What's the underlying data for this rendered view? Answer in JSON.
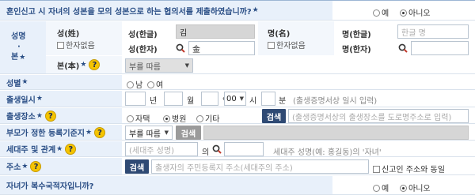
{
  "marriage": {
    "question": "혼인신고 시 자녀의 성본을 모의 성본으로 하는 협의서를 제출하였습니까?",
    "yes": "예",
    "no": "아니오",
    "selected": "no"
  },
  "name": {
    "label": "성명",
    "dot": "·",
    "bon_label": "본",
    "surname_label": "성(姓)",
    "no_hanja": "한자없음",
    "surname_hangul_label": "성(한글)",
    "surname_hangul_value": "김",
    "surname_hanja_label": "성(한자)",
    "surname_hanja_value": "金",
    "given_label": "명(名)",
    "given_hangul_label": "명(한글)",
    "given_hangul_placeholder": "한글 명",
    "given_hanja_label": "명(한자)",
    "bon_sub_label": "본(本)",
    "bon_select": "부를 따름"
  },
  "gender": {
    "label": "성별",
    "male": "남",
    "female": "여"
  },
  "birth": {
    "label": "출생일시",
    "year": "년",
    "month": "월",
    "day": "일",
    "hour_value": "00",
    "hour": "시",
    "minute": "분",
    "hint": "(출생증명서상 일시 입력)"
  },
  "birthplace": {
    "label": "출생장소",
    "opt1": "자택",
    "opt2": "병원",
    "opt3": "기타",
    "search": "검색",
    "placeholder": "(출생증명서상의 출생장소를 도로명주소로 입력)"
  },
  "registry": {
    "label": "부모가 정한 등록기준지",
    "select": "부를 따름",
    "search": "검색"
  },
  "householder": {
    "label": "세대주 및 관계",
    "placeholder": "(세대주 성명)",
    "of": "의",
    "hint": "세대주 성명(예: 홍길동)의 '자녀'"
  },
  "address": {
    "label": "주소",
    "search": "검색",
    "placeholder": "출생자의 주민등록지 주소(세대주의 주소)",
    "same_label": "신고인 주소와 동일"
  },
  "dual": {
    "question": "자녀가 복수국적자입니까?",
    "yes": "예",
    "no": "아니오",
    "selected": "no"
  },
  "colors": {
    "label_bg": "#e8f0fa",
    "label_text": "#2b4f86",
    "button": "#2f4a74",
    "help": "#f5c400"
  }
}
